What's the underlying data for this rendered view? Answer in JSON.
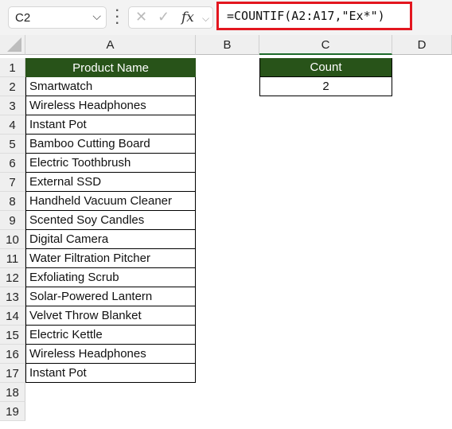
{
  "toolbar": {
    "name_box": "C2",
    "formula": "=COUNTIF(A2:A17,\"Ex*\")",
    "fx_label": "fx",
    "cancel_icon": "✕",
    "enter_icon": "✓"
  },
  "columns": [
    "A",
    "B",
    "C",
    "D"
  ],
  "rows": [
    "1",
    "2",
    "3",
    "4",
    "5",
    "6",
    "7",
    "8",
    "9",
    "10",
    "11",
    "12",
    "13",
    "14",
    "15",
    "16",
    "17",
    "18",
    "19"
  ],
  "sheet": {
    "header_product": "Product Name",
    "header_count": "Count",
    "count_value": "2",
    "products": [
      "Smartwatch",
      "Wireless Headphones",
      "Instant Pot",
      "Bamboo Cutting Board",
      "Electric Toothbrush",
      "External SSD",
      "Handheld Vacuum Cleaner",
      "Scented Soy Candles",
      "Digital Camera",
      "Water Filtration Pitcher",
      "Exfoliating Scrub",
      "Solar-Powered Lantern",
      "Velvet Throw Blanket",
      "Electric Kettle",
      "Wireless Headphones",
      "Instant Pot"
    ]
  },
  "colors": {
    "header_fill": "#285319",
    "highlight_border": "#e3161f"
  }
}
